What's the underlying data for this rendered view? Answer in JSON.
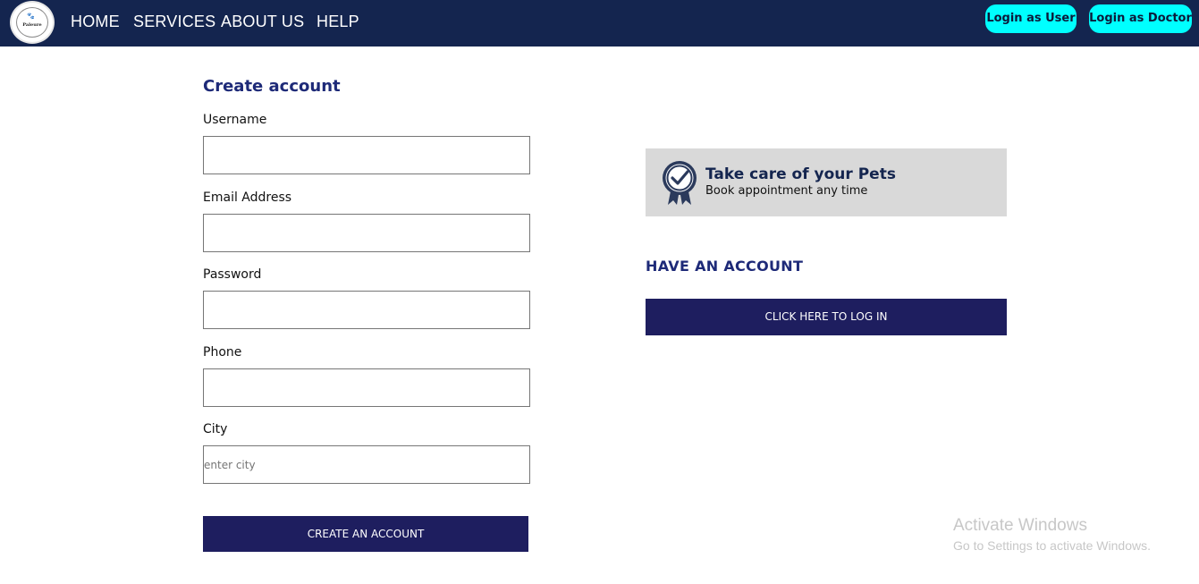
{
  "nav": {
    "logo_word": "Paleure",
    "links": [
      "HOME",
      "SERVICES",
      "ABOUT US",
      "HELP"
    ],
    "login_user": "Login as User",
    "login_doctor": "Login as Doctor",
    "accent_color": "#00ffff",
    "bar_color": "#14254f"
  },
  "form": {
    "title": "Create account",
    "fields": [
      {
        "label": "Username",
        "value": "",
        "placeholder": ""
      },
      {
        "label": "Email Address",
        "value": "",
        "placeholder": ""
      },
      {
        "label": "Password",
        "value": "",
        "placeholder": ""
      },
      {
        "label": "Phone",
        "value": "",
        "placeholder": ""
      },
      {
        "label": "City",
        "value": "",
        "placeholder": "enter city"
      }
    ],
    "submit": "CREATE AN ACCOUNT"
  },
  "promo": {
    "icon": "award-badge-icon",
    "title": "Take care of your Pets",
    "subtitle": "Book appointment any time"
  },
  "account": {
    "heading": "HAVE AN ACCOUNT",
    "login_button": "CLICK HERE TO LOG IN"
  },
  "watermark": {
    "title": "Activate Windows",
    "subtitle": "Go to Settings to activate Windows."
  }
}
